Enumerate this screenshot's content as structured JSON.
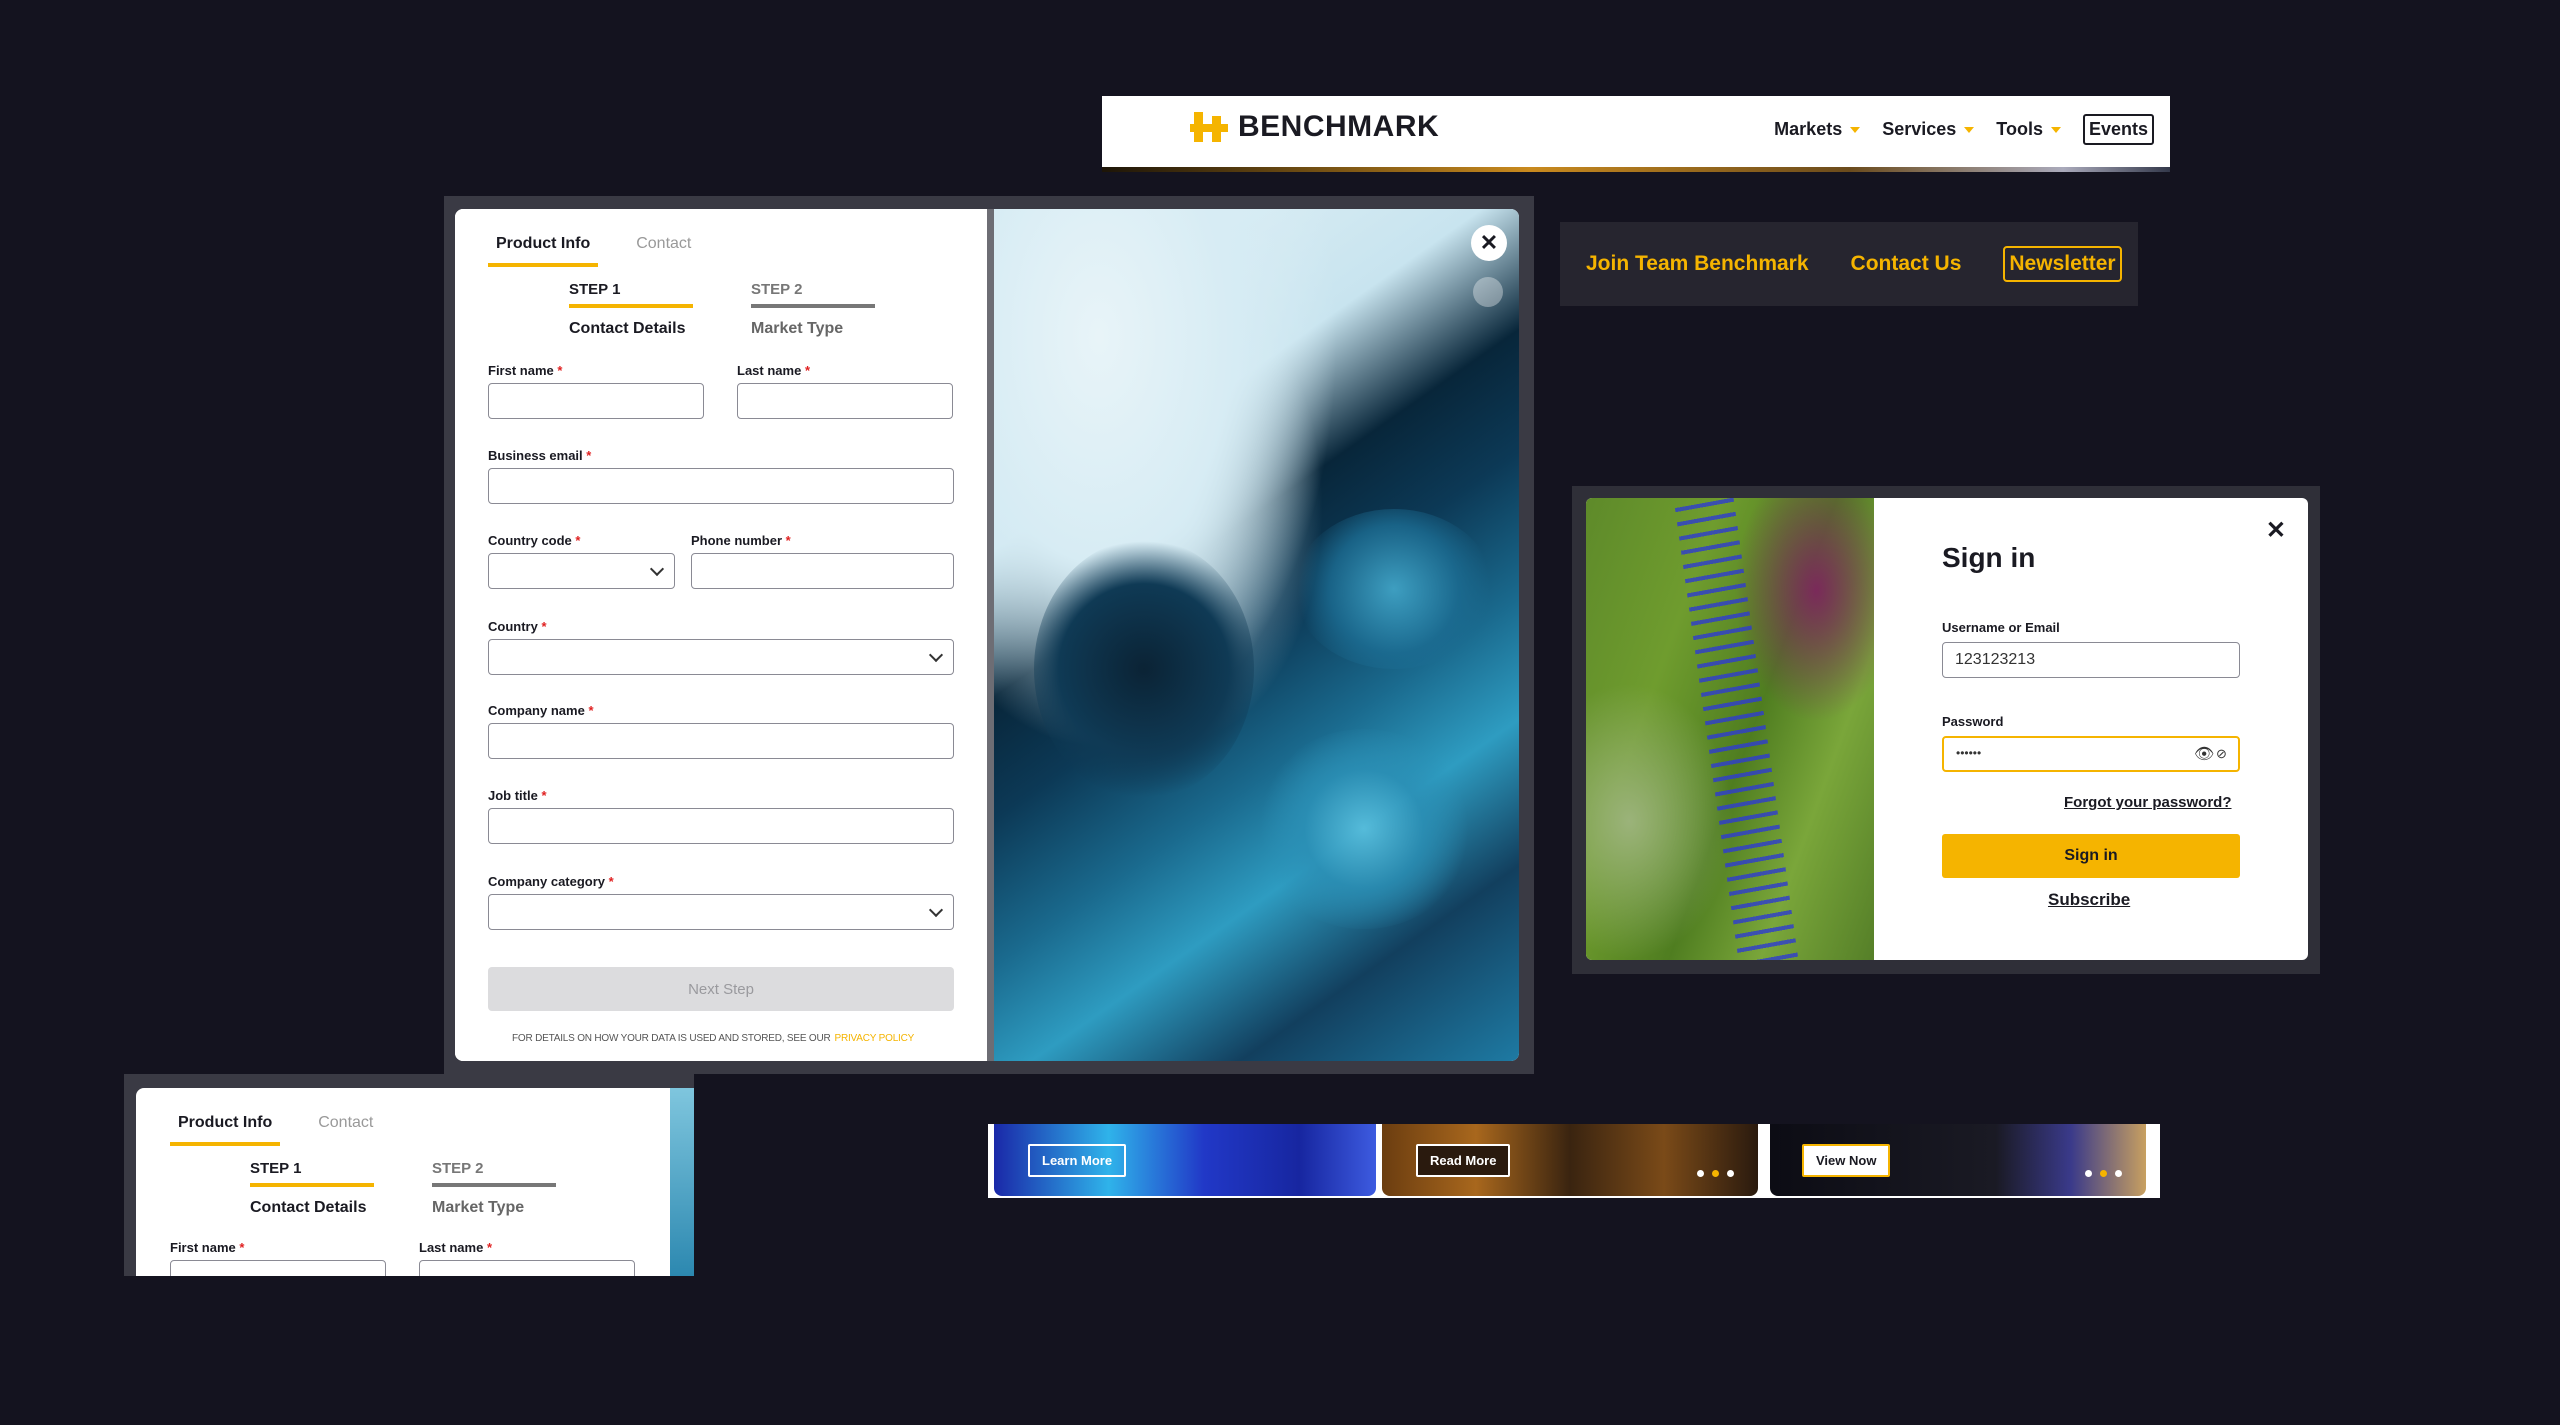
{
  "header": {
    "brand": "BENCHMARK",
    "nav": [
      {
        "label": "Markets"
      },
      {
        "label": "Services"
      },
      {
        "label": "Tools"
      }
    ],
    "events_label": "Events"
  },
  "footer_nav": {
    "join": "Join Team Benchmark",
    "contact": "Contact Us",
    "newsletter": "Newsletter"
  },
  "form": {
    "tabs": [
      "Product Info",
      "Contact"
    ],
    "steps": [
      {
        "num": "STEP 1",
        "name": "Contact Details"
      },
      {
        "num": "STEP 2",
        "name": "Market Type"
      }
    ],
    "fields": {
      "first_name": "First name",
      "last_name": "Last name",
      "business_email": "Business email",
      "country_code": "Country code",
      "phone_number": "Phone number",
      "country": "Country",
      "company_name": "Company name",
      "job_title": "Job title",
      "company_category": "Company category"
    },
    "required_mark": "*",
    "next_step": "Next Step",
    "disclaimer": "FOR DETAILS ON HOW YOUR DATA IS USED AND STORED, SEE OUR",
    "privacy_policy": "PRIVACY POLICY"
  },
  "signin": {
    "title": "Sign in",
    "username_label": "Username or Email",
    "username_value": "123123213",
    "password_label": "Password",
    "password_value": "••••••",
    "forgot": "Forgot your password?",
    "button": "Sign in",
    "subscribe": "Subscribe"
  },
  "banners": [
    {
      "button": "Learn More"
    },
    {
      "button": "Read More"
    },
    {
      "button": "View Now"
    }
  ],
  "colors": {
    "accent": "#f5b400",
    "background": "#14131f"
  }
}
